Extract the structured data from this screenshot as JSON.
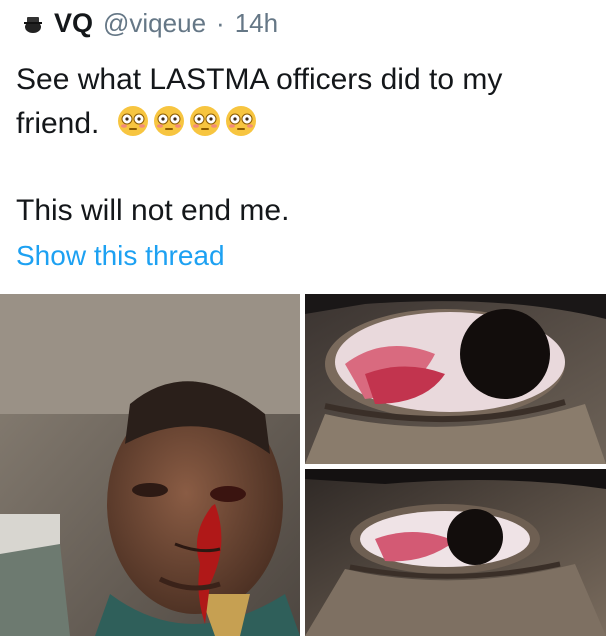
{
  "tweet": {
    "display_name": "VQ",
    "handle": "@viqeue",
    "separator": "·",
    "time": "14h",
    "text_line1": "See what LASTMA officers did to my",
    "text_line2": "friend.",
    "emoji_count": 4,
    "emoji_name": "flushed-face",
    "text_line3": "This will not end me.",
    "thread_link": "Show this thread"
  },
  "colors": {
    "text": "#14171a",
    "muted": "#657786",
    "link": "#1da1f2"
  },
  "media": {
    "photos": [
      {
        "name": "photo-injured-face"
      },
      {
        "name": "photo-eye-closeup-top"
      },
      {
        "name": "photo-eye-closeup-bottom"
      }
    ]
  }
}
